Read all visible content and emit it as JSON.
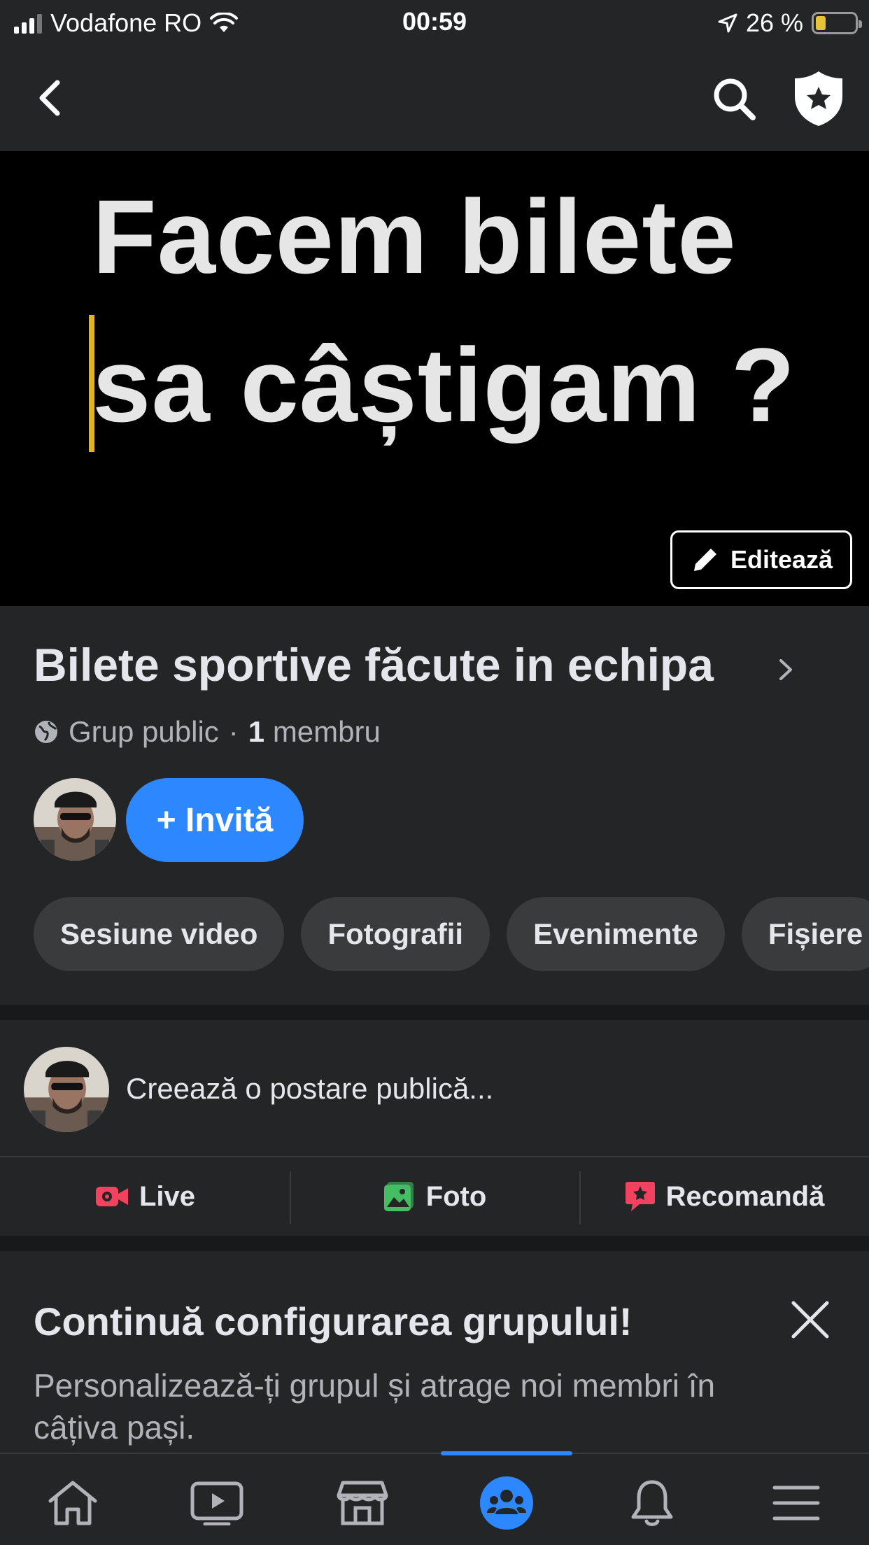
{
  "status_bar": {
    "carrier": "Vodafone RO",
    "time": "00:59",
    "battery_percent": "26 %",
    "battery_level": 0.26,
    "icons": [
      "signal-icon",
      "wifi-icon",
      "location-arrow-icon",
      "battery-icon"
    ]
  },
  "nav": {
    "icons": [
      "back-chevron-icon",
      "search-icon",
      "admin-shield-icon"
    ]
  },
  "cover": {
    "line1": "Facem bilete",
    "line2": "sa câștigam ?",
    "edit_label": "Editează"
  },
  "group": {
    "name": "Bilete sportive făcute  in echipa",
    "privacy": "Grup public",
    "separator": "·",
    "member_count": "1",
    "member_label": "membru",
    "invite_label": "+ Invită"
  },
  "chips": [
    {
      "label": "Sesiune video"
    },
    {
      "label": "Fotografii"
    },
    {
      "label": "Evenimente"
    },
    {
      "label": "Fișiere"
    }
  ],
  "composer": {
    "placeholder": "Creează o postare publică..."
  },
  "actions": [
    {
      "label": "Live",
      "icon": "live-video-icon",
      "color": "#f3425f"
    },
    {
      "label": "Foto",
      "icon": "photo-icon",
      "color": "#45bd62"
    },
    {
      "label": "Recomandă",
      "icon": "recommend-icon",
      "color": "#f3425f"
    }
  ],
  "setup": {
    "title": "Continuă configurarea grupului!",
    "description": "Personalizează-ți grupul și atrage noi membri în câțiva pași."
  },
  "tabs": [
    {
      "icon": "home-icon",
      "active": false
    },
    {
      "icon": "watch-icon",
      "active": false
    },
    {
      "icon": "marketplace-icon",
      "active": false
    },
    {
      "icon": "groups-icon",
      "active": true
    },
    {
      "icon": "notifications-icon",
      "active": false
    },
    {
      "icon": "menu-icon",
      "active": false
    }
  ],
  "colors": {
    "accent": "#2d88ff",
    "background": "#242526",
    "chip": "#3a3b3c",
    "cursor": "#e0b31f"
  }
}
